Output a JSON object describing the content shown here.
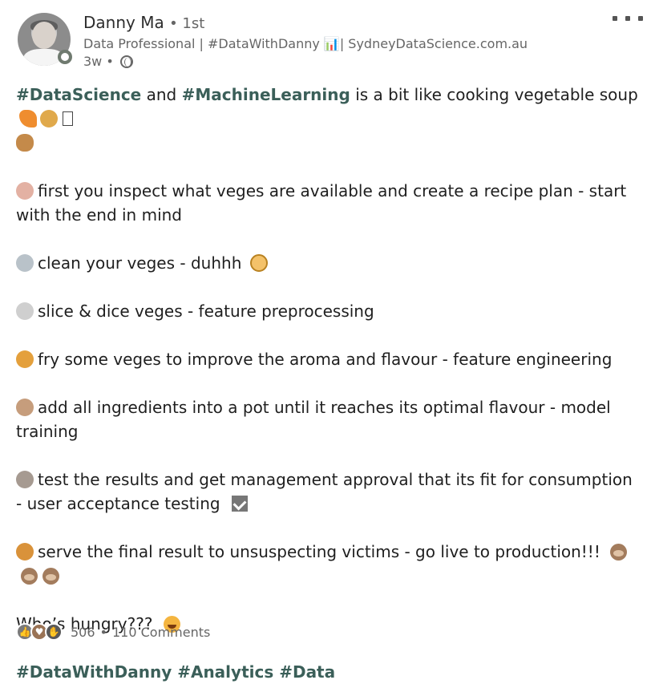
{
  "author": {
    "name": "Danny Ma",
    "degree": "1st",
    "headline": "Data Professional | #DataWithDanny 📊| SydneyDataScience.com.au",
    "time": "3w"
  },
  "post": {
    "intro_tags": [
      "#DataScience",
      "#MachineLearning"
    ],
    "intro_text": [
      "and",
      "is a bit like cooking vegetable soup"
    ],
    "steps": [
      "first you inspect what veges are available and create a recipe plan - start with the end in mind",
      "clean your veges - duhhh",
      "slice & dice veges - feature preprocessing",
      "fry some veges to improve the aroma and flavour - feature engineering",
      "add all ingredients into a pot until it reaches its optimal flavour - model training",
      "test the results and get management approval that its fit for consumption - user acceptance testing",
      "serve the final result to unsuspecting victims - go live to production!!!"
    ],
    "closing": "Who’s hungry???",
    "hashtags": "#DataWithDanny #Analytics #Data"
  },
  "footer": {
    "reaction_count": "506",
    "separator": "•",
    "comments": "110 Comments"
  },
  "icons": {
    "carrot": "carrot-icon",
    "corn": "corn-icon",
    "potato": "potato-icon",
    "detective": "detective-icon",
    "sponge": "sponge-icon",
    "knife": "knife-icon",
    "oil": "oil-icon",
    "pot": "pot-icon",
    "chef": "chef-icon",
    "plate": "plate-icon",
    "monkey": "monkey-icon",
    "laugh": "laughing-face-icon"
  }
}
